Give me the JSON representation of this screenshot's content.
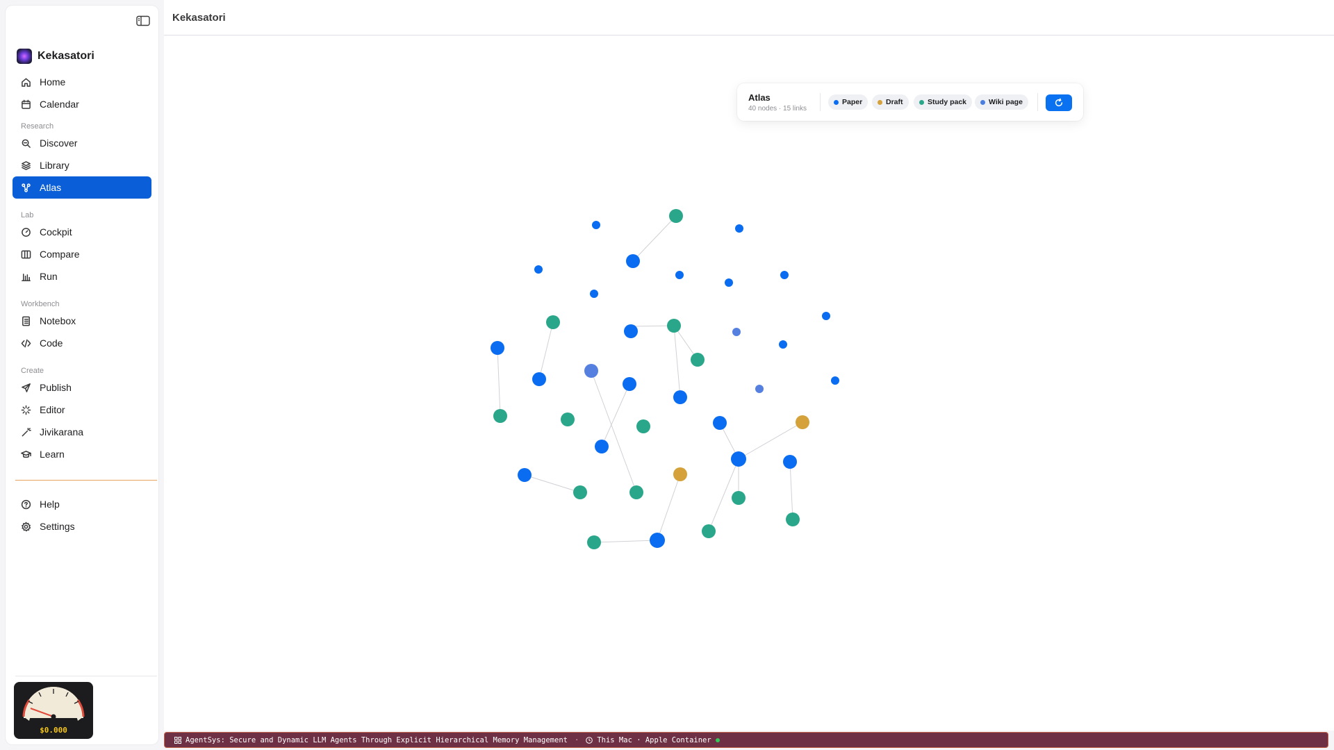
{
  "app": {
    "name": "Kekasatori",
    "topbar_title": "Kekasatori"
  },
  "sidebar": {
    "top_items": [
      {
        "label": "Home",
        "icon": "home-icon"
      },
      {
        "label": "Calendar",
        "icon": "calendar-icon"
      }
    ],
    "sections": [
      {
        "label": "Research",
        "items": [
          {
            "label": "Discover",
            "icon": "search-icon"
          },
          {
            "label": "Library",
            "icon": "layers-icon"
          },
          {
            "label": "Atlas",
            "icon": "graph-icon",
            "active": true
          }
        ]
      },
      {
        "label": "Lab",
        "items": [
          {
            "label": "Cockpit",
            "icon": "gauge-icon"
          },
          {
            "label": "Compare",
            "icon": "columns-icon"
          },
          {
            "label": "Run",
            "icon": "bar-chart-icon"
          }
        ]
      },
      {
        "label": "Workbench",
        "items": [
          {
            "label": "Notebox",
            "icon": "notebook-icon"
          },
          {
            "label": "Code",
            "icon": "code-icon"
          }
        ]
      },
      {
        "label": "Create",
        "items": [
          {
            "label": "Publish",
            "icon": "send-icon"
          },
          {
            "label": "Editor",
            "icon": "sparkle-icon"
          },
          {
            "label": "Jivikarana",
            "icon": "wand-icon"
          },
          {
            "label": "Learn",
            "icon": "graduation-cap-icon"
          }
        ]
      }
    ],
    "bottom_items": [
      {
        "label": "Help",
        "icon": "help-icon"
      },
      {
        "label": "Settings",
        "icon": "gear-icon"
      }
    ],
    "cost": "$0.000"
  },
  "atlas": {
    "title": "Atlas",
    "subtitle": "40 nodes · 15 links",
    "legend": [
      {
        "label": "Paper",
        "color": "#0a6cf0"
      },
      {
        "label": "Draft",
        "color": "#d4a13a"
      },
      {
        "label": "Study pack",
        "color": "#2aa68a"
      },
      {
        "label": "Wiki page",
        "color": "#4a7fe0"
      }
    ]
  },
  "graph": {
    "colors": {
      "paper": "#0a6cf0",
      "draft": "#d4a13a",
      "study": "#2aa68a",
      "wiki": "#5580e0"
    },
    "link_color": "#d1d1d6",
    "nodes": [
      {
        "id": 0,
        "kind": "study"
      },
      {
        "id": 1,
        "kind": "paper"
      },
      {
        "id": 2,
        "kind": "paper"
      },
      {
        "id": 3,
        "kind": "paper"
      },
      {
        "id": 4,
        "kind": "paper"
      },
      {
        "id": 5,
        "kind": "paper"
      },
      {
        "id": 6,
        "kind": "paper"
      },
      {
        "id": 7,
        "kind": "paper"
      },
      {
        "id": 8,
        "kind": "paper"
      },
      {
        "id": 9,
        "kind": "paper"
      },
      {
        "id": 10,
        "kind": "study"
      },
      {
        "id": 11,
        "kind": "paper"
      },
      {
        "id": 12,
        "kind": "study"
      },
      {
        "id": 13,
        "kind": "wiki"
      },
      {
        "id": 14,
        "kind": "paper"
      },
      {
        "id": 15,
        "kind": "paper"
      },
      {
        "id": 16,
        "kind": "study"
      },
      {
        "id": 17,
        "kind": "paper"
      },
      {
        "id": 18,
        "kind": "paper"
      },
      {
        "id": 19,
        "kind": "wiki"
      },
      {
        "id": 20,
        "kind": "paper"
      },
      {
        "id": 21,
        "kind": "wiki"
      },
      {
        "id": 22,
        "kind": "study"
      },
      {
        "id": 23,
        "kind": "study"
      },
      {
        "id": 24,
        "kind": "study"
      },
      {
        "id": 25,
        "kind": "paper"
      },
      {
        "id": 26,
        "kind": "draft"
      },
      {
        "id": 27,
        "kind": "paper"
      },
      {
        "id": 28,
        "kind": "paper"
      },
      {
        "id": 29,
        "kind": "paper"
      },
      {
        "id": 30,
        "kind": "draft"
      },
      {
        "id": 31,
        "kind": "study"
      },
      {
        "id": 32,
        "kind": "study"
      },
      {
        "id": 33,
        "kind": "study"
      },
      {
        "id": 34,
        "kind": "study"
      },
      {
        "id": 35,
        "kind": "study"
      },
      {
        "id": 36,
        "kind": "paper"
      },
      {
        "id": 37,
        "kind": "study"
      },
      {
        "id": 38,
        "kind": "paper"
      },
      {
        "id": 39,
        "kind": "paper"
      }
    ],
    "links": [
      [
        0,
        1
      ],
      [
        2,
        3
      ],
      [
        10,
        17
      ],
      [
        11,
        12
      ],
      [
        11,
        16
      ],
      [
        12,
        18
      ],
      [
        22,
        20
      ],
      [
        23,
        20
      ],
      [
        23,
        19
      ],
      [
        25,
        27
      ],
      [
        26,
        27
      ],
      [
        27,
        33
      ],
      [
        27,
        32
      ],
      [
        27,
        35
      ],
      [
        28,
        34
      ],
      [
        29,
        36
      ],
      [
        30,
        36
      ],
      [
        30,
        37
      ],
      [
        36,
        38
      ],
      [
        39,
        31
      ]
    ]
  },
  "status_bar": {
    "paper_title": "AgentSys: Secure and Dynamic LLM Agents Through Explicit Hierarchical Memory Management",
    "environment": "This Mac · Apple Container"
  }
}
